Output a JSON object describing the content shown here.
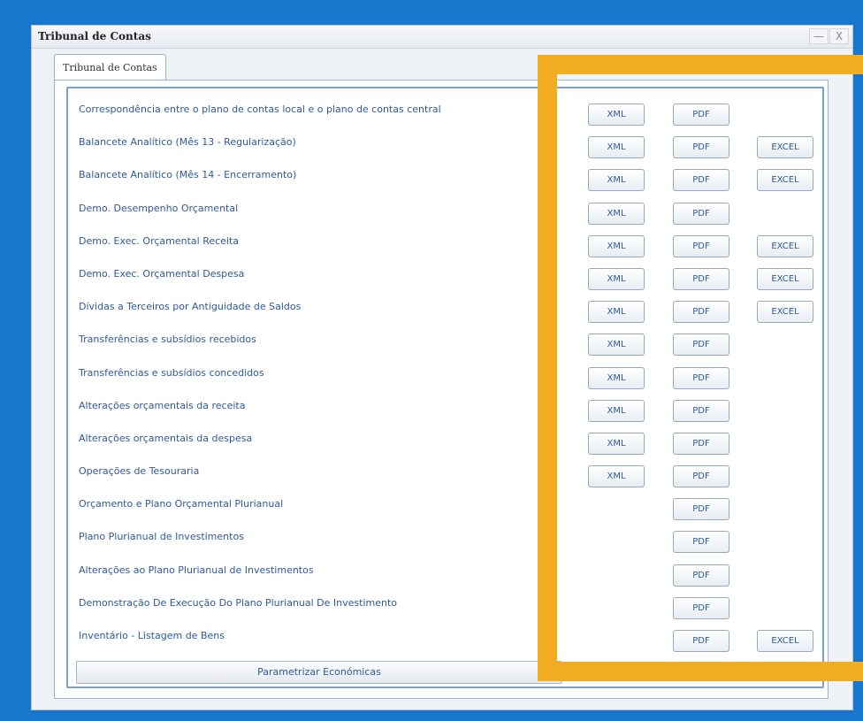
{
  "window": {
    "title": "Tribunal de Contas",
    "minimize_glyph": "—",
    "close_glyph": "X"
  },
  "tab": {
    "label": "Tribunal de Contas"
  },
  "reports": [
    {
      "label": "Correspondência entre o plano de contas local e o plano de contas central",
      "xml": "XML",
      "pdf": "PDF",
      "excel": ""
    },
    {
      "label": "Balancete Analítico (Mês 13 - Regularização)",
      "xml": "XML",
      "pdf": "PDF",
      "excel": "EXCEL"
    },
    {
      "label": "Balancete Analítico (Mês 14 - Encerramento)",
      "xml": "XML",
      "pdf": "PDF",
      "excel": "EXCEL"
    },
    {
      "label": "Demo. Desempenho Orçamental",
      "xml": "XML",
      "pdf": "PDF",
      "excel": ""
    },
    {
      "label": "Demo. Exec. Orçamental Receita",
      "xml": "XML",
      "pdf": "PDF",
      "excel": "EXCEL"
    },
    {
      "label": "Demo. Exec. Orçamental Despesa",
      "xml": "XML",
      "pdf": "PDF",
      "excel": "EXCEL"
    },
    {
      "label": "Dívidas a Terceiros por Antiguidade de Saldos",
      "xml": "XML",
      "pdf": "PDF",
      "excel": "EXCEL"
    },
    {
      "label": "Transferências e subsídios recebidos",
      "xml": "XML",
      "pdf": "PDF",
      "excel": ""
    },
    {
      "label": "Transferências e subsídios concedidos",
      "xml": "XML",
      "pdf": "PDF",
      "excel": ""
    },
    {
      "label": "Alterações orçamentais da receita",
      "xml": "XML",
      "pdf": "PDF",
      "excel": ""
    },
    {
      "label": "Alterações orçamentais da despesa",
      "xml": "XML",
      "pdf": "PDF",
      "excel": ""
    },
    {
      "label": "Operações de Tesouraria",
      "xml": "XML",
      "pdf": "PDF",
      "excel": ""
    },
    {
      "label": "Orçamento e Plano Orçamental Plurianual",
      "xml": "",
      "pdf": "PDF",
      "excel": ""
    },
    {
      "label": "Plano Plurianual de Investimentos",
      "xml": "",
      "pdf": "PDF",
      "excel": ""
    },
    {
      "label": "Alterações ao Plano Plurianual de Investimentos",
      "xml": "",
      "pdf": "PDF",
      "excel": ""
    },
    {
      "label": "Demonstração De Execução Do Plano Plurianual De Investimento",
      "xml": "",
      "pdf": "PDF",
      "excel": ""
    },
    {
      "label": "Inventário - Listagem de Bens",
      "xml": "",
      "pdf": "PDF",
      "excel": "EXCEL"
    }
  ],
  "footer": {
    "param_button": "Parametrizar Económicas"
  },
  "colors": {
    "background": "#1677cc",
    "highlight": "#f1ad21",
    "link_text": "#2e5a9a"
  }
}
